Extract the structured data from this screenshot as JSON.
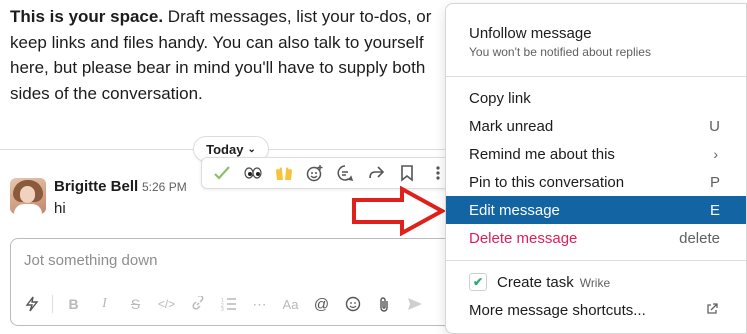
{
  "intro": {
    "bold": "This is your space.",
    "text": " Draft messages, list your to-dos, or keep links and files handy. You can also talk to yourself here, but please bear in mind you'll have to supply both sides of the conversation."
  },
  "divider": {
    "label": "Today"
  },
  "message": {
    "sender": "Brigitte Bell",
    "time": "5:26 PM",
    "text": "hi"
  },
  "hover_actions": [
    "checkmark-icon",
    "eyes-icon",
    "raised-hands-icon",
    "add-reaction-icon",
    "reply-in-thread-icon",
    "share-icon",
    "bookmark-icon",
    "more-actions-icon"
  ],
  "composer": {
    "placeholder": "Jot something down"
  },
  "menu": {
    "unfollow": {
      "label": "Unfollow message",
      "sub": "You won't be notified about replies"
    },
    "copy_link": {
      "label": "Copy link"
    },
    "mark_unread": {
      "label": "Mark unread",
      "key": "U"
    },
    "remind": {
      "label": "Remind me about this",
      "key": "›"
    },
    "pin": {
      "label": "Pin to this conversation",
      "key": "P"
    },
    "edit": {
      "label": "Edit message",
      "key": "E"
    },
    "delete": {
      "label": "Delete message",
      "key": "delete"
    },
    "create_task": {
      "label": "Create task",
      "app": "Wrike"
    },
    "more_shortcuts": {
      "label": "More message shortcuts..."
    }
  },
  "colors": {
    "active_bg": "#1264a3",
    "danger": "#e01e5a",
    "arrow": "#e0201b"
  }
}
